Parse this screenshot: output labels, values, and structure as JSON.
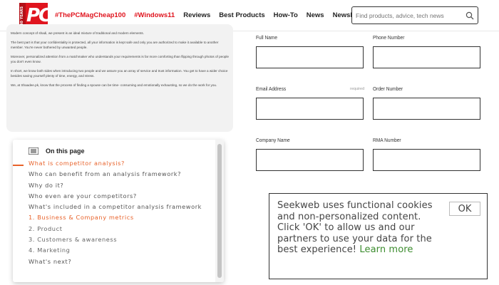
{
  "header": {
    "logo": {
      "main": "PC",
      "strip": "40 YEARS"
    },
    "nav": [
      {
        "label": "#ThePCMagCheap100",
        "style": "red"
      },
      {
        "label": "#Windows11",
        "style": "red"
      },
      {
        "label": "Reviews",
        "style": "dark"
      },
      {
        "label": "Best Products",
        "style": "dark"
      },
      {
        "label": "How-To",
        "style": "dark"
      },
      {
        "label": "News",
        "style": "dark"
      },
      {
        "label": "Newsletters",
        "style": "dark"
      }
    ],
    "search": {
      "placeholder": "Find products, advice, tech news",
      "icon": "search-icon"
    }
  },
  "article": {
    "paragraphs": [
      "Modern concept of shadi, we present is an ideal mixture of traditional and modern elements.",
      "The best part is that your confidentiality is protected, all your information is kept safe and only you are authorized to make it available to another member. You're never bothered by unwanted people.",
      "Moreover, personalized attention from a matchmaker who understands your requirements is far more comforting than flipping through photos of people you don't even know.",
      "In short, we know both sides when introducing two people and we assure you an array of service and trust information. You get to have a wider choice besides saving yourself plenty of time, energy, and stress.",
      "We, at Shaadee.pk, know that the process of finding a spouse can be time- consuming and emotionally exhausting, so we do the work for you."
    ]
  },
  "toc": {
    "title": "On this page",
    "icon": "list-icon",
    "items": [
      {
        "label": "What is competitor analysis?",
        "active": true,
        "sub": false
      },
      {
        "label": "Who can benefit from an analysis framework?",
        "active": false,
        "sub": false
      },
      {
        "label": "Why do it?",
        "active": false,
        "sub": false
      },
      {
        "label": "Who even are your competitors?",
        "active": false,
        "sub": false
      },
      {
        "label": "What's included in a competitor analysis framework",
        "active": false,
        "sub": false
      },
      {
        "label": "1. Business & Company metrics",
        "active": true,
        "sub": true
      },
      {
        "label": "2. Product",
        "active": false,
        "sub": true
      },
      {
        "label": "3. Customers & awareness",
        "active": false,
        "sub": true
      },
      {
        "label": "4. Marketing",
        "active": false,
        "sub": true
      },
      {
        "label": "What's next?",
        "active": false,
        "sub": false
      }
    ]
  },
  "form": {
    "full_name": "Full Name",
    "phone": "Phone Number",
    "email": "Email Address",
    "email_required": "required",
    "order": "Order Number",
    "company": "Company Name",
    "rma": "RMA Number"
  },
  "cookie": {
    "text": "Seekweb uses functional cookies and non-personalized content. Click 'OK' to allow us and our partners to use your data for the best experience!",
    "link": "Learn more",
    "ok": "OK"
  },
  "colors": {
    "brand_red": "#e0141e",
    "toc_accent": "#e8622a",
    "link_green": "#3c8c2e"
  }
}
